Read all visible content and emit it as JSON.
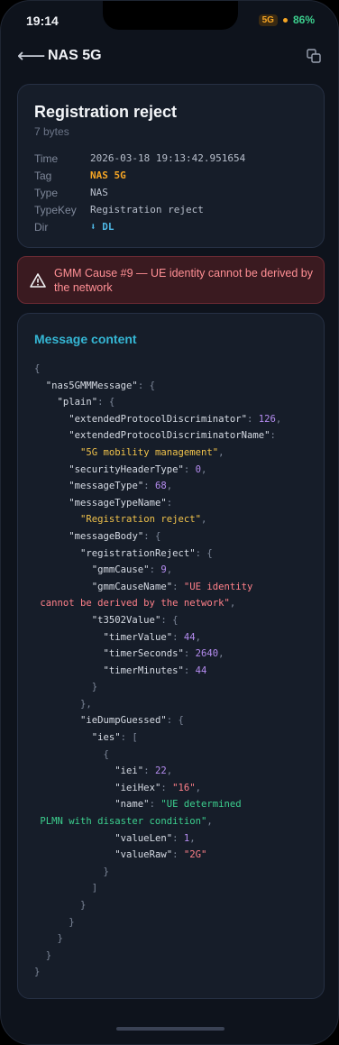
{
  "status": {
    "time": "19:14",
    "network": "5G",
    "battery": "86%"
  },
  "header": {
    "title": "NAS 5G"
  },
  "info": {
    "title": "Registration reject",
    "size": "7 bytes",
    "rows": [
      {
        "key": "Time",
        "value": "2026-03-18 19:13:42.951654"
      },
      {
        "key": "Tag",
        "value": "NAS 5G"
      },
      {
        "key": "Type",
        "value": "NAS"
      },
      {
        "key": "TypeKey",
        "value": "Registration reject"
      },
      {
        "key": "Dir",
        "value": "⬇ DL"
      }
    ]
  },
  "alert": {
    "text": "GMM Cause #9 — UE identity cannot be derived by the network"
  },
  "content": {
    "title": "Message content",
    "lines": [
      [
        [
          "pn",
          "{"
        ]
      ],
      [
        [
          "pn",
          "  "
        ],
        [
          "key",
          "\"nas5GMMMessage\""
        ],
        [
          "pn",
          ": {"
        ]
      ],
      [
        [
          "pn",
          "    "
        ],
        [
          "key",
          "\"plain\""
        ],
        [
          "pn",
          ": {"
        ]
      ],
      [
        [
          "pn",
          "      "
        ],
        [
          "key",
          "\"extendedProtocolDiscriminator\""
        ],
        [
          "pn",
          ": "
        ],
        [
          "num",
          "126"
        ],
        [
          "pn",
          ","
        ]
      ],
      [
        [
          "pn",
          "      "
        ],
        [
          "key",
          "\"extendedProtocolDiscriminatorName\""
        ],
        [
          "pn",
          ":"
        ]
      ],
      [
        [
          "pn",
          "        "
        ],
        [
          "str-y",
          "\"5G mobility management\""
        ],
        [
          "pn",
          ","
        ]
      ],
      [
        [
          "pn",
          "      "
        ],
        [
          "key",
          "\"securityHeaderType\""
        ],
        [
          "pn",
          ": "
        ],
        [
          "num",
          "0"
        ],
        [
          "pn",
          ","
        ]
      ],
      [
        [
          "pn",
          "      "
        ],
        [
          "key",
          "\"messageType\""
        ],
        [
          "pn",
          ": "
        ],
        [
          "num",
          "68"
        ],
        [
          "pn",
          ","
        ]
      ],
      [
        [
          "pn",
          "      "
        ],
        [
          "key",
          "\"messageTypeName\""
        ],
        [
          "pn",
          ":"
        ]
      ],
      [
        [
          "pn",
          "        "
        ],
        [
          "str-y",
          "\"Registration reject\""
        ],
        [
          "pn",
          ","
        ]
      ],
      [
        [
          "pn",
          "      "
        ],
        [
          "key",
          "\"messageBody\""
        ],
        [
          "pn",
          ": {"
        ]
      ],
      [
        [
          "pn",
          "        "
        ],
        [
          "key",
          "\"registrationReject\""
        ],
        [
          "pn",
          ": {"
        ]
      ],
      [
        [
          "pn",
          "          "
        ],
        [
          "key",
          "\"gmmCause\""
        ],
        [
          "pn",
          ": "
        ],
        [
          "num",
          "9"
        ],
        [
          "pn",
          ","
        ]
      ],
      [
        [
          "pn",
          "          "
        ],
        [
          "key",
          "\"gmmCauseName\""
        ],
        [
          "pn",
          ": "
        ],
        [
          "str-r",
          "\"UE identity"
        ]
      ],
      [
        [
          "str-r",
          " cannot be derived by the network\""
        ],
        [
          "pn",
          ","
        ]
      ],
      [
        [
          "pn",
          "          "
        ],
        [
          "key",
          "\"t3502Value\""
        ],
        [
          "pn",
          ": {"
        ]
      ],
      [
        [
          "pn",
          "            "
        ],
        [
          "key",
          "\"timerValue\""
        ],
        [
          "pn",
          ": "
        ],
        [
          "num",
          "44"
        ],
        [
          "pn",
          ","
        ]
      ],
      [
        [
          "pn",
          "            "
        ],
        [
          "key",
          "\"timerSeconds\""
        ],
        [
          "pn",
          ": "
        ],
        [
          "num",
          "2640"
        ],
        [
          "pn",
          ","
        ]
      ],
      [
        [
          "pn",
          "            "
        ],
        [
          "key",
          "\"timerMinutes\""
        ],
        [
          "pn",
          ": "
        ],
        [
          "num",
          "44"
        ]
      ],
      [
        [
          "pn",
          "          }"
        ]
      ],
      [
        [
          "pn",
          "        },"
        ]
      ],
      [
        [
          "pn",
          "        "
        ],
        [
          "key",
          "\"ieDumpGuessed\""
        ],
        [
          "pn",
          ": {"
        ]
      ],
      [
        [
          "pn",
          "          "
        ],
        [
          "key",
          "\"ies\""
        ],
        [
          "pn",
          ": ["
        ]
      ],
      [
        [
          "pn",
          "            {"
        ]
      ],
      [
        [
          "pn",
          "              "
        ],
        [
          "key",
          "\"iei\""
        ],
        [
          "pn",
          ": "
        ],
        [
          "num",
          "22"
        ],
        [
          "pn",
          ","
        ]
      ],
      [
        [
          "pn",
          "              "
        ],
        [
          "key",
          "\"ieiHex\""
        ],
        [
          "pn",
          ": "
        ],
        [
          "str-r",
          "\"16\""
        ],
        [
          "pn",
          ","
        ]
      ],
      [
        [
          "pn",
          "              "
        ],
        [
          "key",
          "\"name\""
        ],
        [
          "pn",
          ": "
        ],
        [
          "str-g",
          "\"UE determined"
        ]
      ],
      [
        [
          "str-g",
          " PLMN with disaster condition\""
        ],
        [
          "pn",
          ","
        ]
      ],
      [
        [
          "pn",
          "              "
        ],
        [
          "key",
          "\"valueLen\""
        ],
        [
          "pn",
          ": "
        ],
        [
          "num",
          "1"
        ],
        [
          "pn",
          ","
        ]
      ],
      [
        [
          "pn",
          "              "
        ],
        [
          "key",
          "\"valueRaw\""
        ],
        [
          "pn",
          ": "
        ],
        [
          "str-r",
          "\"2G\""
        ]
      ],
      [
        [
          "pn",
          "            }"
        ]
      ],
      [
        [
          "pn",
          "          ]"
        ]
      ],
      [
        [
          "pn",
          "        }"
        ]
      ],
      [
        [
          "pn",
          "      }"
        ]
      ],
      [
        [
          "pn",
          "    }"
        ]
      ],
      [
        [
          "pn",
          "  }"
        ]
      ],
      [
        [
          "pn",
          "}"
        ]
      ]
    ]
  }
}
